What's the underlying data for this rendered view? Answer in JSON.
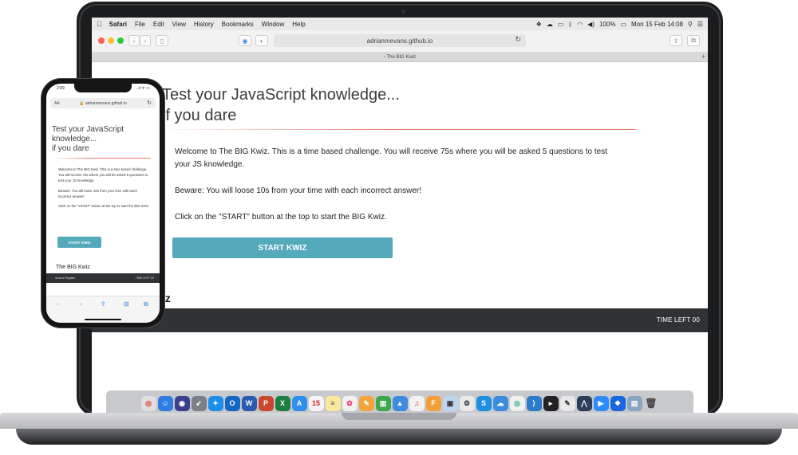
{
  "menubar": {
    "apple": "",
    "items": [
      "Safari",
      "File",
      "Edit",
      "View",
      "History",
      "Bookmarks",
      "Window",
      "Help"
    ],
    "battery": "100%",
    "datetime": "Mon 15 Feb  14:08"
  },
  "browser": {
    "address": "adrianmevans.github.io",
    "tab_title": "The BIG Kwiz"
  },
  "page": {
    "title_line1": "Test your JavaScript knowledge...",
    "title_line2": "if you dare",
    "paragraph1": "Welcome to The BIG Kwiz. This is a time based challenge. You will receive 75s where you will be asked 5 questions to test your JS knowledge.",
    "paragraph2": "Beware: You will loose 10s from your time with each incorrect answer!",
    "paragraph3": "Click on the \"START\" button at the top to start the BIG Kwiz.",
    "start_button": "START KWIZ",
    "heading_fragment": "iz",
    "timer": "TIME LEFT 00"
  },
  "phone": {
    "time": "2:09",
    "status_icons": "..ıl ᯤ ▭",
    "aa": "AA",
    "address": "🔒 adrianmevans.github.io",
    "title_line1": "Test your JavaScript",
    "title_line2": "knowledge...",
    "title_line3": "if you dare",
    "paragraph1": "Welcome to The BIG Kwiz. This is a time based challenge. You will receive 75s where you will be asked 5 questions to test your JS knowledge.",
    "paragraph2": "Beware: You will loose 10s from your time with each incorrect answer!",
    "paragraph3": "Click on the \"START\" button at the top to start the BIG Kwiz.",
    "start_button": "START KWIZ",
    "heading": "The BIG Kwiz",
    "footer_left": "Scores Register",
    "footer_right": "TIME LEFT 00"
  },
  "colors": {
    "accent_button": "#54a9bb",
    "rule": "#e57865",
    "footer": "#2f3336"
  }
}
